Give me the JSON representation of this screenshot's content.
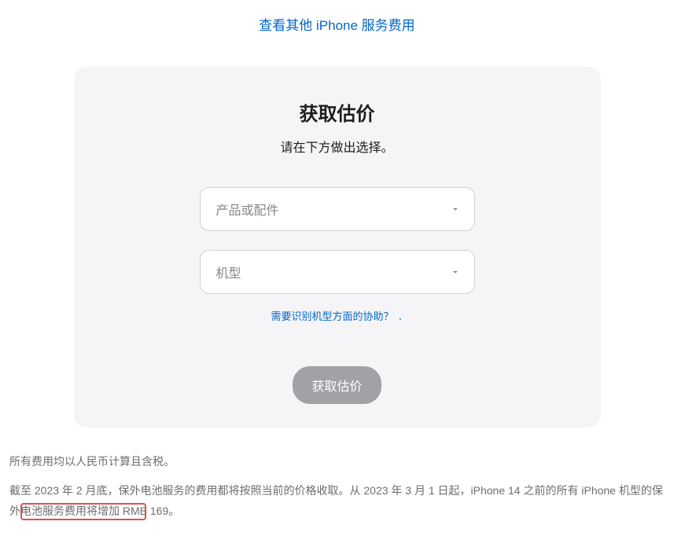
{
  "topLink": {
    "label": "查看其他 iPhone 服务费用"
  },
  "card": {
    "title": "获取估价",
    "subtitle": "请在下方做出选择。",
    "productSelect": {
      "placeholder": "产品或配件"
    },
    "modelSelect": {
      "placeholder": "机型"
    },
    "helpLink": {
      "label": "需要识别机型方面的协助？"
    },
    "submitButton": {
      "label": "获取估价"
    }
  },
  "footer": {
    "line1": "所有费用均以人民币计算且含税。",
    "line2": "截至 2023 年 2 月底，保外电池服务的费用都将按照当前的价格收取。从 2023 年 3 月 1 日起，iPhone 14 之前的所有 iPhone 机型的保外电池服务费用将增加 RMB 169。"
  }
}
